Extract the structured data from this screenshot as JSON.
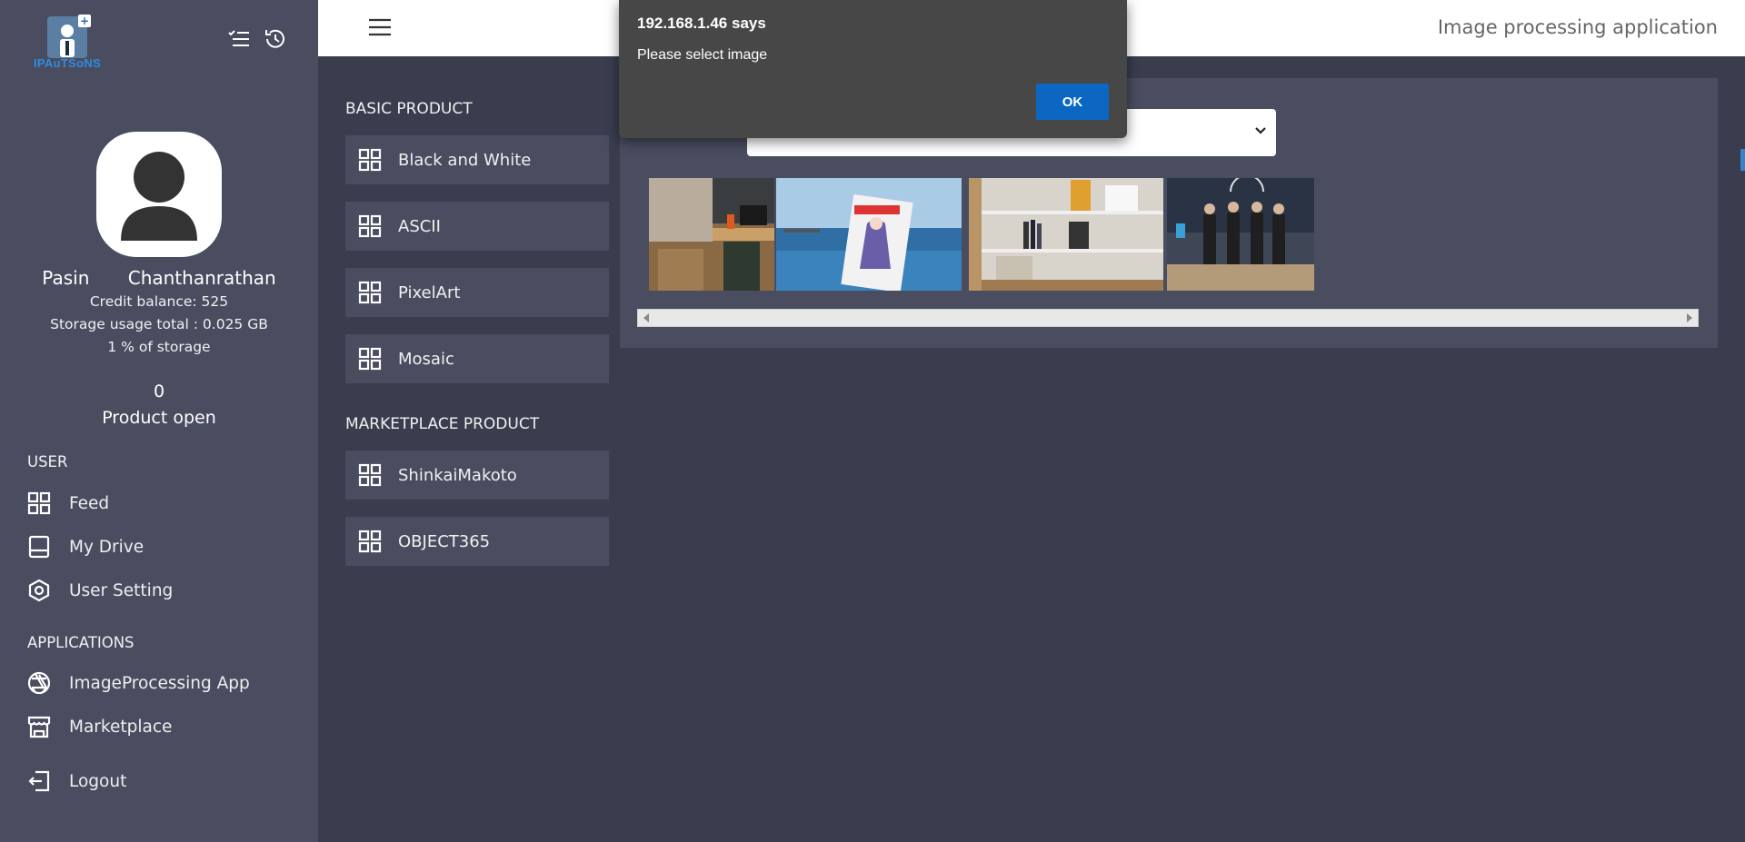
{
  "sidebar": {
    "logo_text": "IPAuTSoNS",
    "user_first": "Pasin",
    "user_last": "Chanthanrathan",
    "credit": "Credit balance: 525",
    "storage_total": "Storage usage total : 0.025 GB",
    "storage_percent": "1 % of storage",
    "product_open_count": "0",
    "product_open_label": "Product open",
    "user_section": "USER",
    "applications_section": "APPLICATIONS",
    "nav": {
      "feed": "Feed",
      "my_drive": "My Drive",
      "user_setting": "User Setting",
      "imageprocessing": "ImageProcessing App",
      "marketplace": "Marketplace",
      "logout": "Logout"
    }
  },
  "header": {
    "app_title": "Image processing application"
  },
  "products": {
    "basic_label": "BASIC PRODUCT",
    "basic": [
      "Black and White",
      "ASCII",
      "PixelArt",
      "Mosaic"
    ],
    "marketplace_label": "MARKETPLACE PRODUCT",
    "marketplace": [
      "ShinkaiMakoto",
      "OBJECT365"
    ]
  },
  "main": {
    "select_value": ""
  },
  "dialog": {
    "title": "192.168.1.46 says",
    "message": "Please select image",
    "ok_label": "OK"
  },
  "colors": {
    "sidebar_bg": "#4a4d60",
    "page_bg": "#3a3d4e",
    "dialog_bg": "#474747",
    "ok_button": "#0b67c2"
  }
}
